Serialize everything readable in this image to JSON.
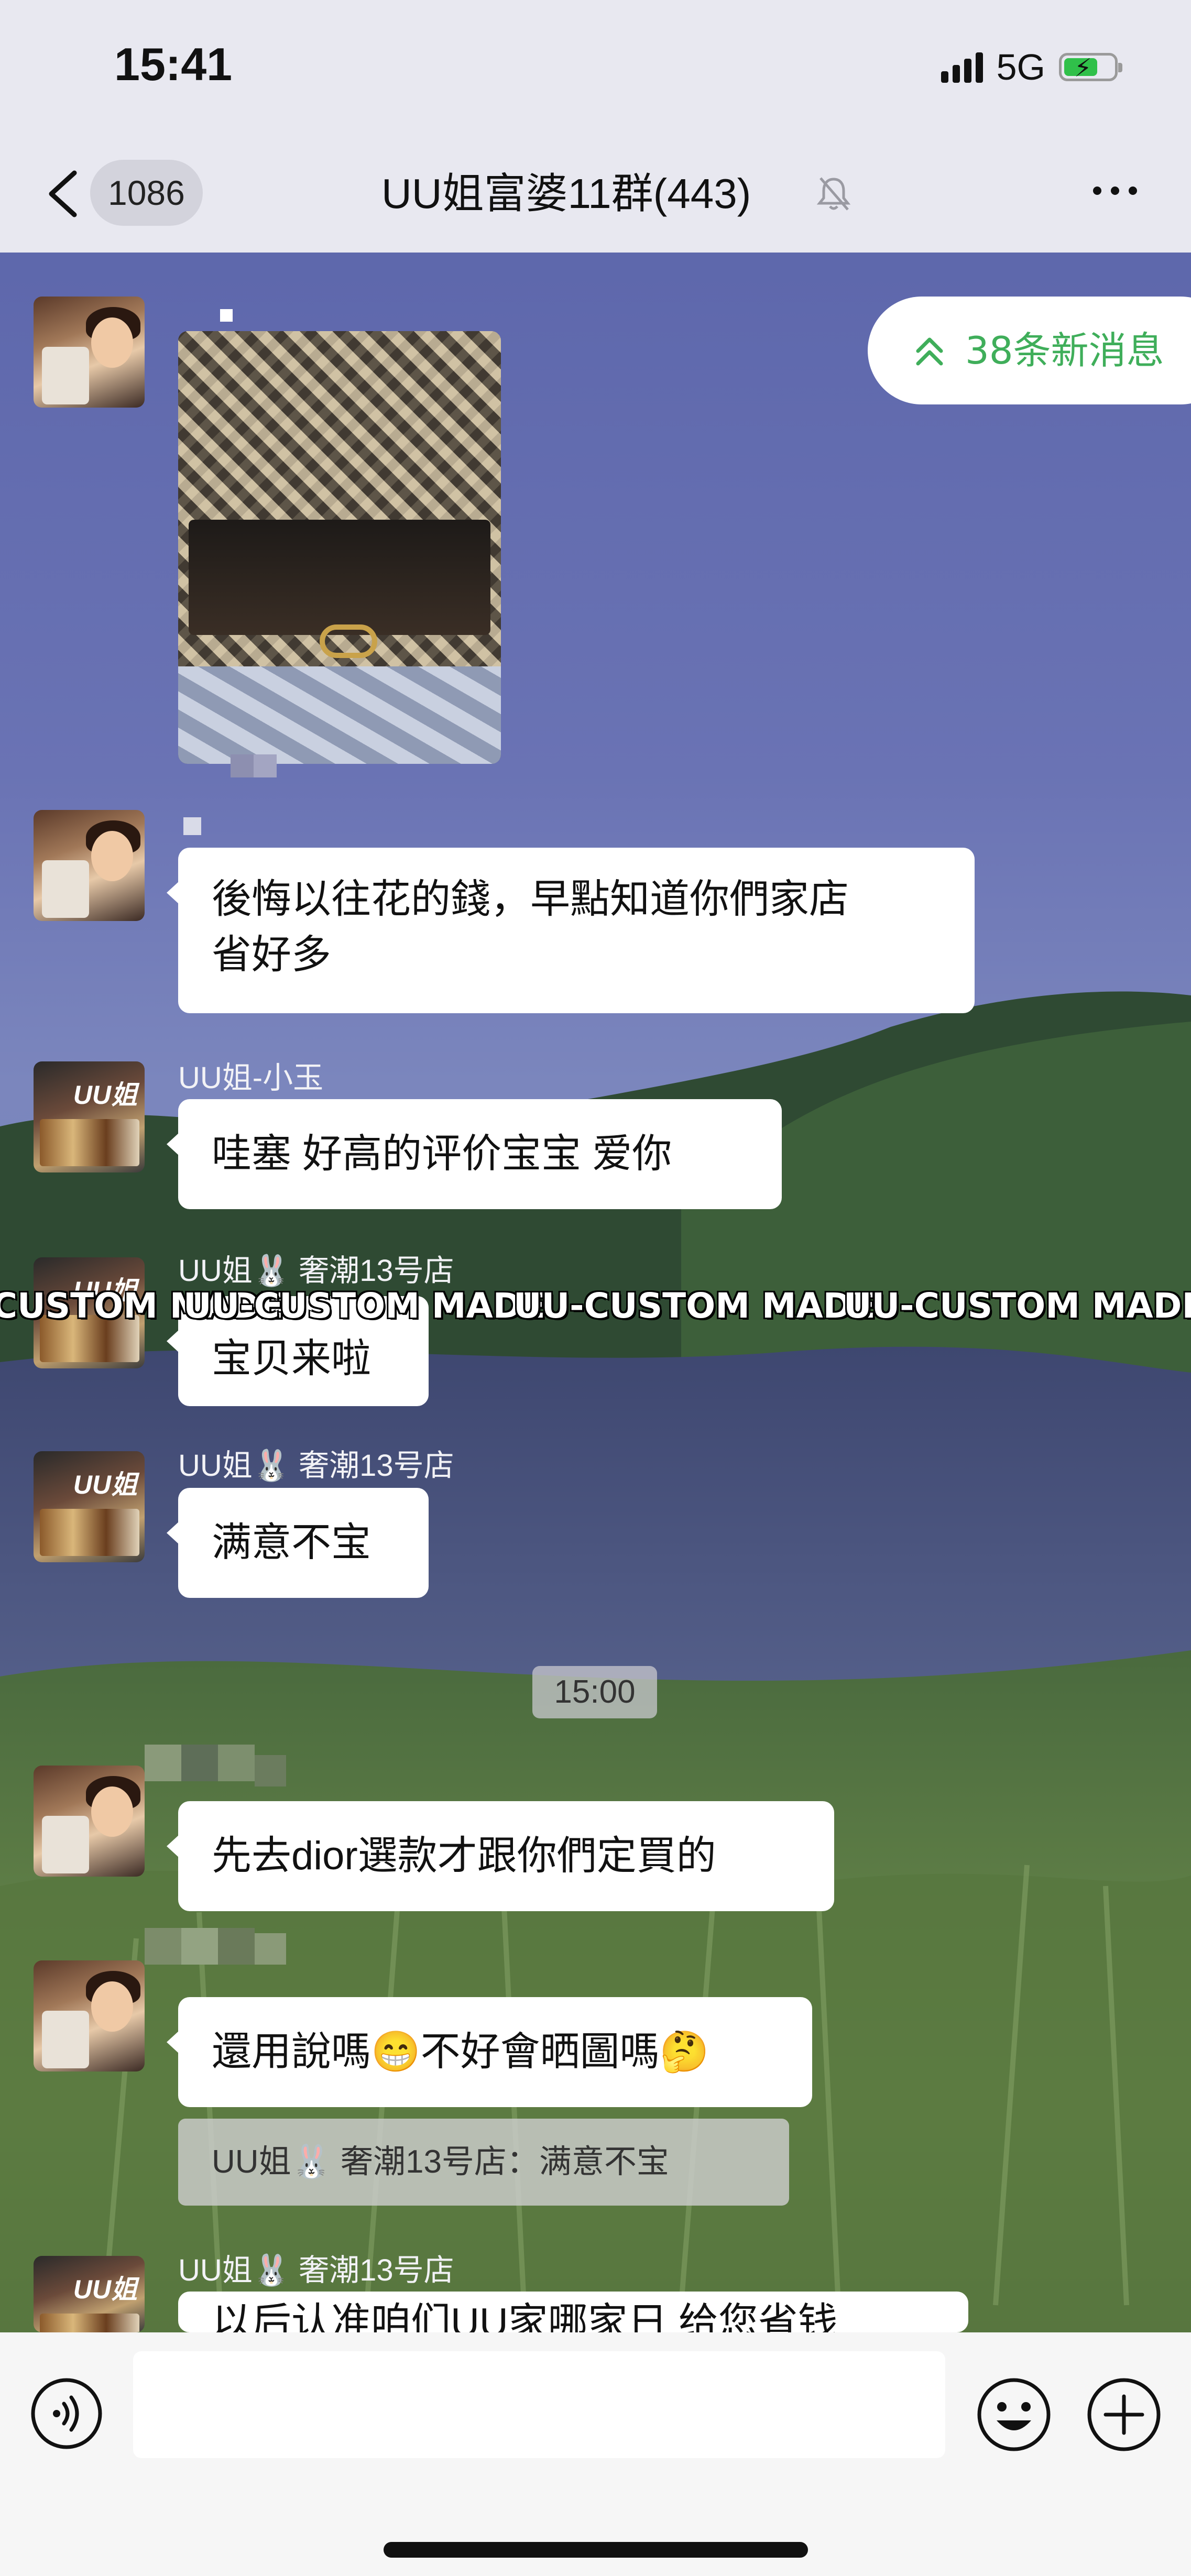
{
  "status_bar": {
    "time": "15:41",
    "network": "5G"
  },
  "nav": {
    "unread_count": "1086",
    "title": "UU姐富婆11群(443)"
  },
  "new_messages": {
    "label": "38条新消息"
  },
  "watermark": "UU-CUSTOM MADE",
  "timestamp": "15:00",
  "messages": [
    {
      "sender": "",
      "type": "image"
    },
    {
      "sender": "",
      "text_line1": "後悔以往花的錢，早點知道你們家店",
      "text_line2": "省好多"
    },
    {
      "sender": "UU姐-小玉",
      "text": "哇塞  好高的评价宝宝 爱你"
    },
    {
      "sender": "UU姐🐰 奢潮13号店",
      "text": "宝贝来啦"
    },
    {
      "sender": "UU姐🐰 奢潮13号店",
      "text": "满意不宝"
    },
    {
      "sender": "",
      "text": "先去dior選款才跟你們定買的"
    },
    {
      "sender": "",
      "text": "還用說嗎😁不好會晒圖嗎🤔",
      "quote": "UU姐🐰 奢潮13号店：满意不宝"
    },
    {
      "sender": "UU姐🐰 奢潮13号店",
      "text": "以后认准咱们UU家哪家日 给您省钱"
    }
  ],
  "colors": {
    "accent_green": "#3fae5a",
    "bubble": "#ffffff",
    "nav_bg": "#e8e8f0"
  }
}
